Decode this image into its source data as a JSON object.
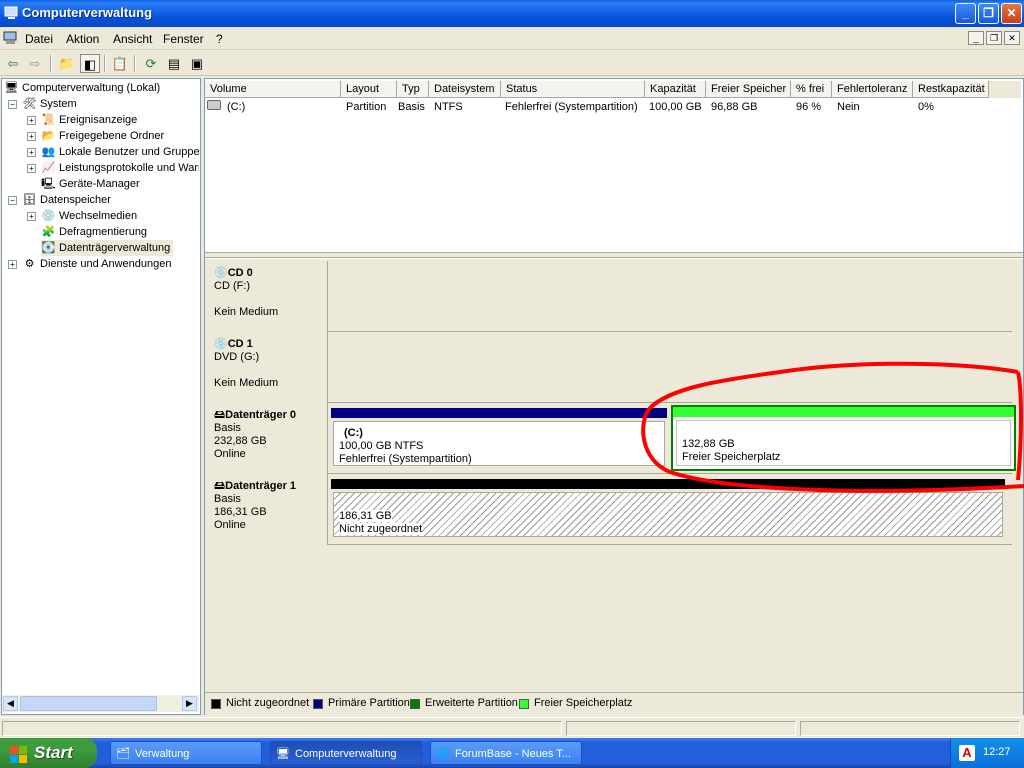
{
  "window": {
    "title": "Computerverwaltung"
  },
  "menu": [
    "Datei",
    "Aktion",
    "Ansicht",
    "Fenster",
    "?"
  ],
  "tree": {
    "root": "Computerverwaltung (Lokal)",
    "system": "System",
    "ereignis": "Ereignisanzeige",
    "freigegeben": "Freigegebene Ordner",
    "benutzer": "Lokale Benutzer und Gruppen",
    "leistung": "Leistungsprotokolle und Warnungen",
    "geraete": "Geräte-Manager",
    "datenspeicher": "Datenspeicher",
    "wechsel": "Wechselmedien",
    "defrag": "Defragmentierung",
    "dtv": "Datenträgerverwaltung",
    "dienste": "Dienste und Anwendungen"
  },
  "columns": [
    "Volume",
    "Layout",
    "Typ",
    "Dateisystem",
    "Status",
    "Kapazität",
    "Freier Speicher",
    "% frei",
    "Fehlertoleranz",
    "Restkapazität"
  ],
  "volume_row": [
    "(C:)",
    "Partition",
    "Basis",
    "NTFS",
    "Fehlerfrei (Systempartition)",
    "100,00 GB",
    "96,88 GB",
    "96 %",
    "Nein",
    "0%"
  ],
  "disks": {
    "cd0": {
      "name": "CD 0",
      "line1": "CD (F:)",
      "line2": "Kein Medium"
    },
    "cd1": {
      "name": "CD 1",
      "line1": "DVD (G:)",
      "line2": "Kein Medium"
    },
    "d0": {
      "name": "Datenträger 0",
      "type": "Basis",
      "size": "232,88 GB",
      "state": "Online",
      "p1_name": "(C:)",
      "p1_size": "100,00 GB NTFS",
      "p1_status": "Fehlerfrei (Systempartition)",
      "p2_size": "132,88 GB",
      "p2_status": "Freier Speicherplatz"
    },
    "d1": {
      "name": "Datenträger 1",
      "type": "Basis",
      "size": "186,31 GB",
      "state": "Online",
      "p1_size": "186,31 GB",
      "p1_status": "Nicht zugeordnet"
    }
  },
  "legend": [
    {
      "label": "Nicht zugeordnet",
      "color": "#000000"
    },
    {
      "label": "Primäre Partition",
      "color": "#000080"
    },
    {
      "label": "Erweiterte Partition",
      "color": "#008000"
    },
    {
      "label": "Freier Speicherplatz",
      "color": "#33ff33"
    }
  ],
  "taskbar": {
    "start": "Start",
    "items": [
      "Verwaltung",
      "Computerverwaltung",
      "ForumBase - Neues T..."
    ],
    "clock": "12:27"
  }
}
